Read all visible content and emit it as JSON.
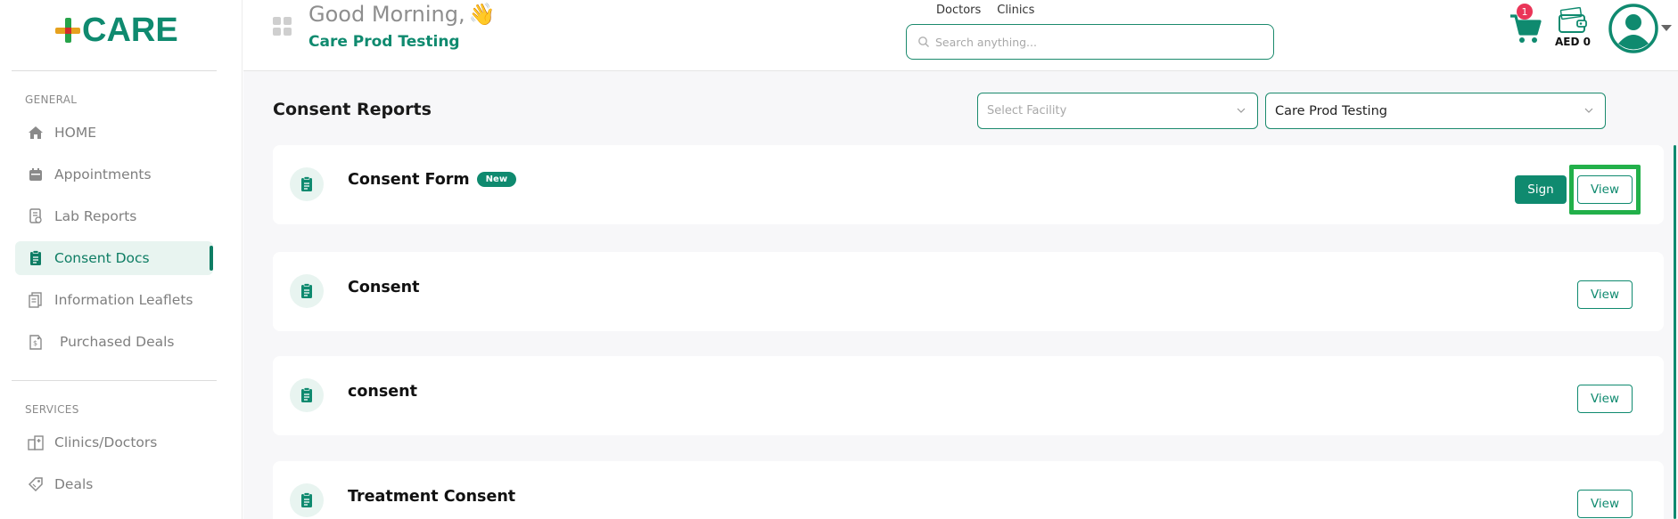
{
  "brand": {
    "logo_text": "CARE",
    "colors": {
      "primary": "#0f8a6f",
      "accent_orange": "#e6a11e",
      "accent_green": "#27a34a",
      "accent_red": "#d42a2a",
      "badge": "#ea3558",
      "highlight": "#22b04a"
    }
  },
  "sidebar": {
    "sections": [
      {
        "label": "GENERAL"
      },
      {
        "label": "SERVICES"
      }
    ],
    "items": [
      {
        "label": "HOME",
        "icon": "home-icon",
        "active": false
      },
      {
        "label": "Appointments",
        "icon": "calendar-icon",
        "active": false
      },
      {
        "label": "Lab Reports",
        "icon": "lab-report-icon",
        "active": false
      },
      {
        "label": "Consent Docs",
        "icon": "clipboard-icon",
        "active": true
      },
      {
        "label": "Information Leaflets",
        "icon": "leaflet-icon",
        "active": false
      },
      {
        "label": "Purchased Deals",
        "icon": "purchased-deals-icon",
        "active": false
      },
      {
        "label": "Clinics/Doctors",
        "icon": "hospital-icon",
        "active": false
      },
      {
        "label": "Deals",
        "icon": "tag-icon",
        "active": false
      }
    ]
  },
  "header": {
    "greeting": "Good Morning,",
    "greeting_emoji": "👋",
    "facility": "Care Prod Testing",
    "search_tabs": [
      "Doctors",
      "Clinics"
    ],
    "search_placeholder": "Search anything...",
    "cart_count": "1",
    "wallet_amount": "AED 0"
  },
  "page": {
    "title": "Consent Reports",
    "facility_select_placeholder": "Select Facility",
    "facility_select_value": "Care Prod Testing"
  },
  "consent_list": [
    {
      "title": "Consent Form",
      "badge": "New",
      "sign_label": "Sign",
      "view_label": "View"
    },
    {
      "title": "Consent",
      "view_label": "View"
    },
    {
      "title": "consent",
      "view_label": "View"
    },
    {
      "title": "Treatment Consent",
      "view_label": "View"
    }
  ]
}
